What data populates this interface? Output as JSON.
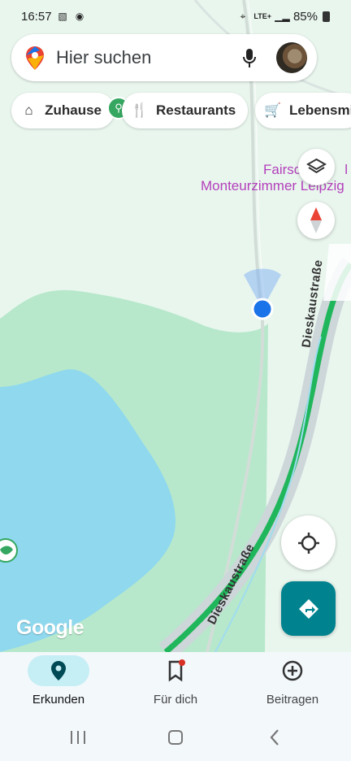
{
  "status_bar": {
    "time": "16:57",
    "network": "LTE+",
    "battery": "85%"
  },
  "search": {
    "placeholder": "Hier suchen"
  },
  "chips": [
    {
      "label": "Zuhause",
      "icon": "home-icon"
    },
    {
      "label": "Restaurants",
      "icon": "restaurant-icon"
    },
    {
      "label": "Lebensmi",
      "icon": "cart-icon"
    }
  ],
  "map": {
    "poi_label_line1": "Fairsc",
    "poi_label_line1_end": "l",
    "poi_label_line2": "Monteurzimmer Leipzig",
    "street_name_1": "Dieskaustraße",
    "street_name_2": "Dieskaustraße",
    "attribution": "Google",
    "colors": {
      "park": "#b7e8cb",
      "water": "#8fd8ee",
      "route": "#20b65b",
      "poi_accent": "#b33fbb"
    }
  },
  "buttons": {
    "layers": "layers-icon",
    "compass": "compass-icon",
    "location": "my-location-icon",
    "route": "directions-icon"
  },
  "bottom_nav": [
    {
      "label": "Erkunden",
      "icon": "location-pin-icon"
    },
    {
      "label": "Für dich",
      "icon": "bookmark-icon"
    },
    {
      "label": "Beitragen",
      "icon": "add-circle-icon"
    }
  ],
  "system_nav": [
    "recent-apps-icon",
    "home-icon",
    "back-icon"
  ]
}
